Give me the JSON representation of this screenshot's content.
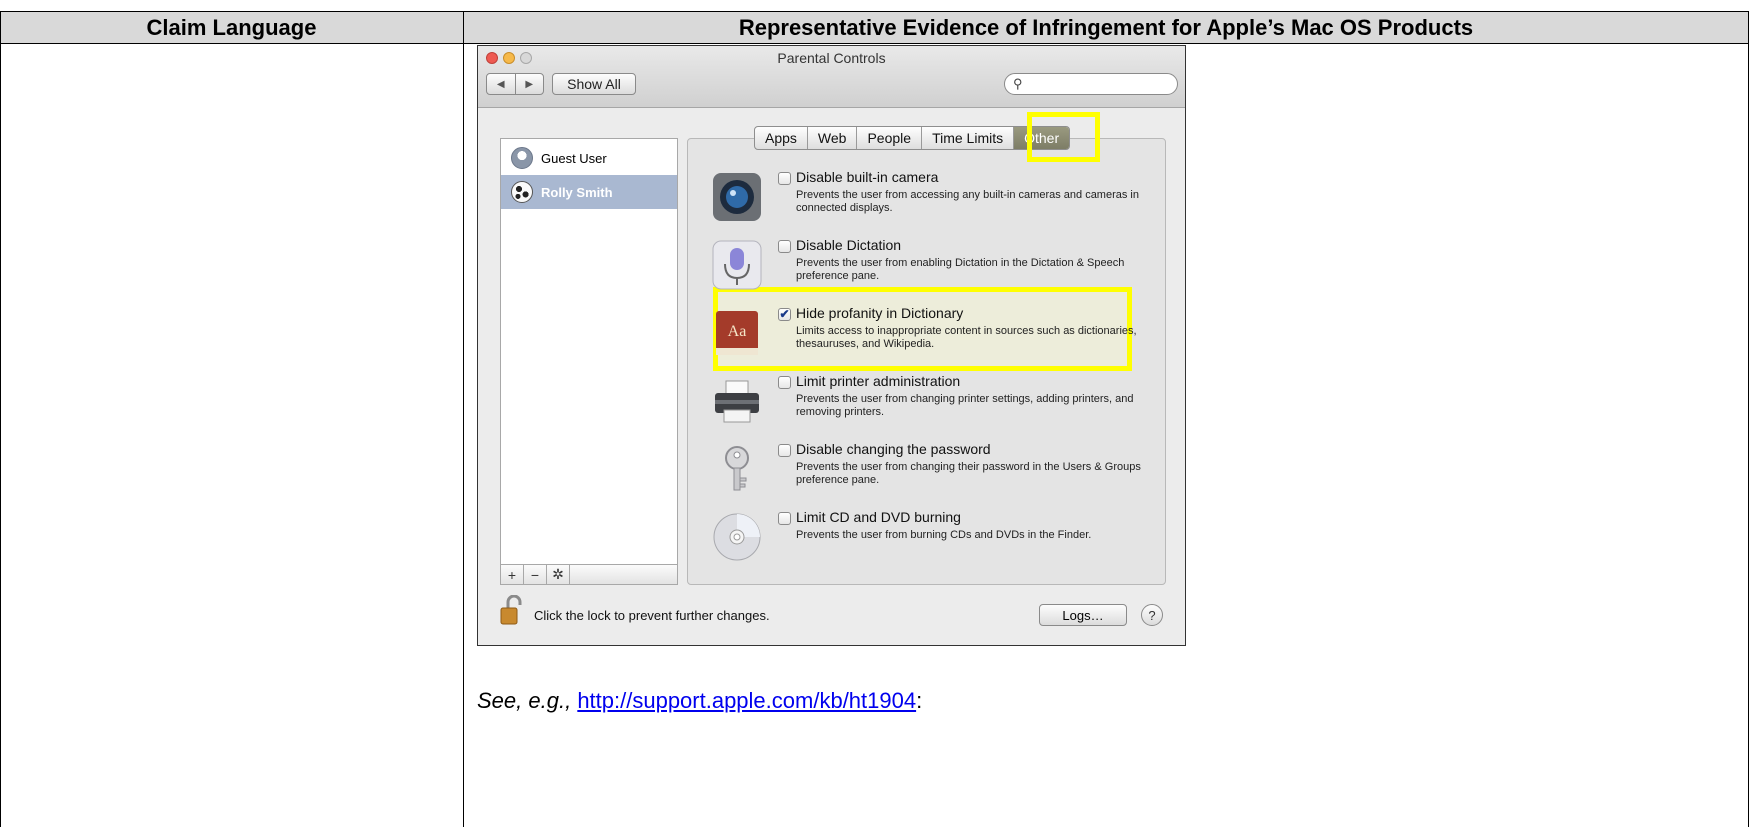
{
  "table": {
    "col1_header": "Claim Language",
    "col2_header": "Representative Evidence of Infringement for Apple’s Mac OS Products"
  },
  "window": {
    "title": "Parental Controls",
    "show_all": "Show All",
    "nav_back": "◀",
    "nav_forward": "▶",
    "search_placeholder": ""
  },
  "users": [
    {
      "name": "Guest User",
      "selected": false
    },
    {
      "name": "Rolly Smith",
      "selected": true
    }
  ],
  "list_tools": [
    "+",
    "−",
    "✲"
  ],
  "tabs": [
    {
      "label": "Apps",
      "active": false
    },
    {
      "label": "Web",
      "active": false
    },
    {
      "label": "People",
      "active": false
    },
    {
      "label": "Time Limits",
      "active": false
    },
    {
      "label": "Other",
      "active": true
    }
  ],
  "options": [
    {
      "icon": "camera-icon",
      "label": "Disable built-in camera",
      "checked": false,
      "desc": "Prevents the user from accessing any built-in cameras and cameras in connected displays."
    },
    {
      "icon": "microphone-icon",
      "label": "Disable Dictation",
      "checked": false,
      "desc": "Prevents the user from enabling Dictation in the Dictation & Speech preference pane."
    },
    {
      "icon": "dictionary-icon",
      "label": "Hide profanity in Dictionary",
      "checked": true,
      "desc": "Limits access to inappropriate content in sources such as dictionaries, thesauruses, and Wikipedia."
    },
    {
      "icon": "printer-icon",
      "label": "Limit printer administration",
      "checked": false,
      "desc": "Prevents the user from changing printer settings, adding printers, and removing printers."
    },
    {
      "icon": "key-icon",
      "label": "Disable changing the password",
      "checked": false,
      "desc": "Prevents the user from changing their password in the Users & Groups preference pane."
    },
    {
      "icon": "cd-icon",
      "label": "Limit CD and DVD burning",
      "checked": false,
      "desc": "Prevents the user from burning CDs and DVDs in the Finder."
    }
  ],
  "footer": {
    "lock_text": "Click the lock to prevent further changes.",
    "logs_button": "Logs…",
    "help_button": "?"
  },
  "see_also": {
    "prefix": "See, e.g.,",
    "link": "http://support.apple.com/kb/ht1904",
    "suffix": ":"
  },
  "colors": {
    "highlight": "#ffff00",
    "header_bg": "#d9d9d9",
    "link": "#0000ee"
  }
}
